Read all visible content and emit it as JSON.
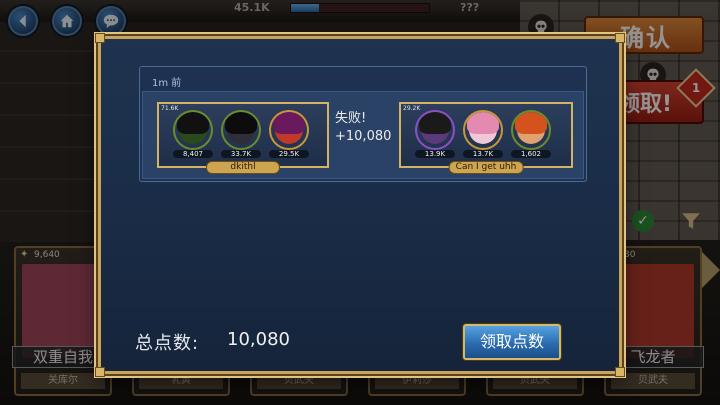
{
  "topbar": {
    "stat_left": "45.1K",
    "stat_right": "???",
    "hp_fraction": 0.2
  },
  "side_buttons": {
    "confirm_label": "确认",
    "claim_label": "领取!",
    "badge_count": "1"
  },
  "cards": [
    {
      "cost": "9,640",
      "title": "双重自我",
      "plate": "关库尔",
      "art": "#a2485a"
    },
    {
      "cost": "",
      "title": "",
      "plate": "乳黄",
      "art": "#3a3530"
    },
    {
      "cost": "",
      "title": "",
      "plate": "贝武夫",
      "art": "#3a3530"
    },
    {
      "cost": "",
      "title": "",
      "plate": "伊莉莎",
      "art": "#3a3530"
    },
    {
      "cost": "",
      "title": "",
      "plate": "贝武夫",
      "art": "#3a3530"
    },
    {
      "cost": "30",
      "title": "飞龙者",
      "plate": "贝武夫",
      "art": "#b33a2a"
    }
  ],
  "modal": {
    "history_time": "1m 前",
    "left_team": {
      "power": "71.6K",
      "name": "dkithl",
      "members": [
        {
          "power": "8,407",
          "face": "#2a4a1c",
          "hair": "#111111",
          "ring": "green"
        },
        {
          "power": "33.7K",
          "face": "#2e2e3a",
          "hair": "#0c0c0c",
          "ring": "green"
        },
        {
          "power": "29.5K",
          "face": "#c0392b",
          "hair": "#6a1a5c",
          "ring": "gold"
        }
      ]
    },
    "result": {
      "status": "失败!",
      "points": "+10,080"
    },
    "right_team": {
      "power": "29.2K",
      "name": "Can I get uhh",
      "members": [
        {
          "power": "13.9K",
          "face": "#5a3a7a",
          "hair": "#1a1a1a",
          "ring": "purple"
        },
        {
          "power": "13.7K",
          "face": "#f0c7d5",
          "hair": "#e48ab0",
          "ring": "gold"
        },
        {
          "power": "1,602",
          "face": "#e0a070",
          "hair": "#d4521e",
          "ring": "green"
        }
      ]
    },
    "total_label": "总点数:",
    "total_value": "10,080",
    "claim_button": "领取点数"
  },
  "colors": {
    "modal_bg": "#1f3350",
    "gold_border": "#c9a35a",
    "accent_blue": "#2a6cb0"
  }
}
